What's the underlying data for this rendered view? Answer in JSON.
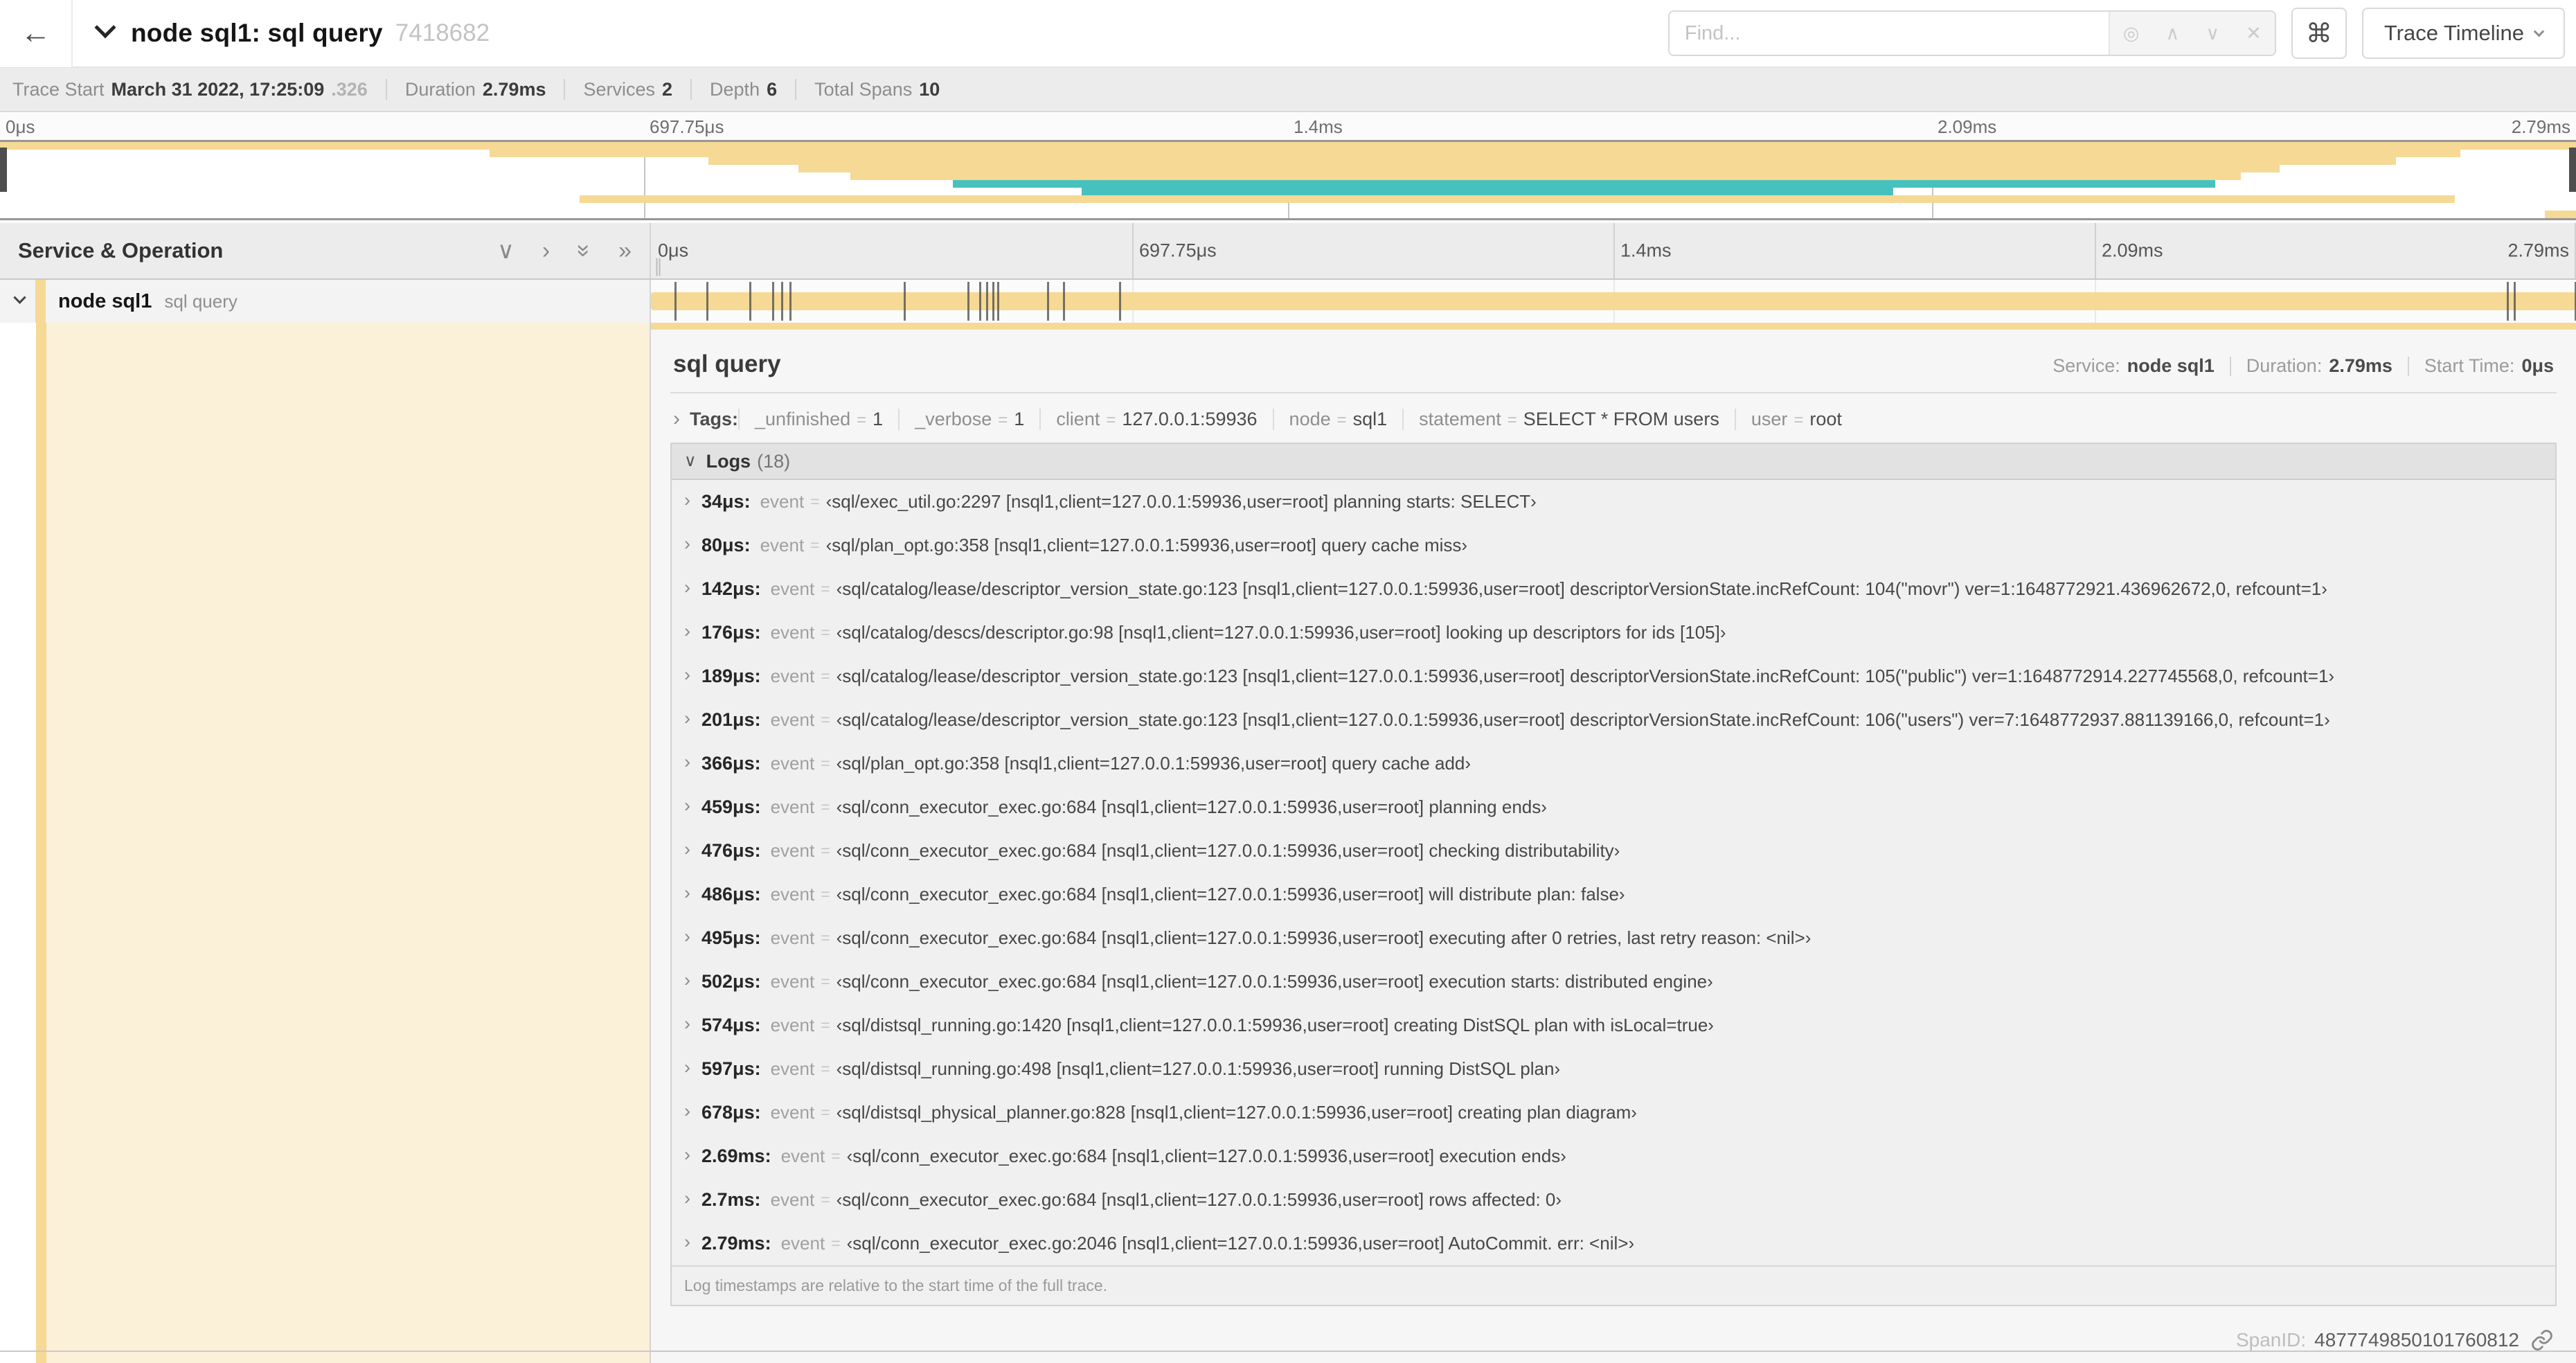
{
  "colors": {
    "tan": "#F5D995",
    "teal": "#47C1BE",
    "grid": "#d0d0d0"
  },
  "header": {
    "back_label": "←",
    "title": "node sql1: sql query",
    "trace_id": "7418682",
    "find_placeholder": "Find...",
    "focus_icon": "◎",
    "prev_icon": "∧",
    "next_icon": "∨",
    "clear_icon": "✕",
    "shortcut": "⌘",
    "view_button": "Trace Timeline"
  },
  "summary": {
    "items": [
      {
        "label": "Trace Start",
        "value": "March 31 2022, 17:25:09",
        "suffix": ".326"
      },
      {
        "label": "Duration",
        "value": "2.79ms",
        "suffix": ""
      },
      {
        "label": "Services",
        "value": "2",
        "suffix": ""
      },
      {
        "label": "Depth",
        "value": "6",
        "suffix": ""
      },
      {
        "label": "Total Spans",
        "value": "10",
        "suffix": ""
      }
    ]
  },
  "minimap": {
    "ticks": [
      {
        "label": "0μs",
        "pct": 0
      },
      {
        "label": "697.75μs",
        "pct": 25
      },
      {
        "label": "1.4ms",
        "pct": 50
      },
      {
        "label": "2.09ms",
        "pct": 75
      },
      {
        "label": "2.79ms",
        "pct": 100
      }
    ],
    "spans": [
      {
        "row": 0,
        "start": 0,
        "end": 100,
        "color": "tan"
      },
      {
        "row": 1,
        "start": 19,
        "end": 95.5,
        "color": "tan"
      },
      {
        "row": 2,
        "start": 27.5,
        "end": 93,
        "color": "tan"
      },
      {
        "row": 3,
        "start": 31,
        "end": 88.5,
        "color": "tan"
      },
      {
        "row": 4,
        "start": 33,
        "end": 87,
        "color": "tan"
      },
      {
        "row": 5,
        "start": 37,
        "end": 86,
        "color": "teal"
      },
      {
        "row": 6,
        "start": 42,
        "end": 73.5,
        "color": "teal"
      },
      {
        "row": 7,
        "start": 22.5,
        "end": 95.3,
        "color": "tan"
      },
      {
        "row": 9,
        "start": 98.8,
        "end": 100,
        "color": "tan"
      }
    ]
  },
  "timeline": {
    "left_header": "Service & Operation",
    "grip": "∥",
    "ticks": [
      {
        "label": "0μs",
        "pct": 0
      },
      {
        "label": "697.75μs",
        "pct": 25
      },
      {
        "label": "1.4ms",
        "pct": 50
      },
      {
        "label": "2.09ms",
        "pct": 75
      },
      {
        "label": "2.79ms",
        "pct": 100
      }
    ],
    "span": {
      "service": "node sql1",
      "operation": "sql query",
      "bar_start": 0,
      "bar_end": 100,
      "color": "tan"
    },
    "log_markers": [
      1.22,
      2.87,
      5.09,
      6.31,
      6.77,
      7.2,
      13.12,
      16.45,
      17.06,
      17.42,
      17.74,
      18.0,
      20.57,
      21.4,
      24.3,
      96.42,
      96.77,
      99.93
    ]
  },
  "detail": {
    "title": "sql query",
    "meta": [
      {
        "label": "Service:",
        "value": "node sql1"
      },
      {
        "label": "Duration:",
        "value": "2.79ms"
      },
      {
        "label": "Start Time:",
        "value": "0μs"
      }
    ],
    "tags_label": "Tags:",
    "tags": [
      {
        "key": "_unfinished",
        "value": "1"
      },
      {
        "key": "_verbose",
        "value": "1"
      },
      {
        "key": "client",
        "value": "127.0.0.1:59936"
      },
      {
        "key": "node",
        "value": "sql1"
      },
      {
        "key": "statement",
        "value": "SELECT * FROM users"
      },
      {
        "key": "user",
        "value": "root"
      }
    ],
    "logs_label": "Logs",
    "logs_count": "(18)",
    "logs": [
      {
        "time": "34μs:",
        "field": "event",
        "value": "‹sql/exec_util.go:2297 [nsql1,client=127.0.0.1:59936,user=root] planning starts: SELECT›"
      },
      {
        "time": "80μs:",
        "field": "event",
        "value": "‹sql/plan_opt.go:358 [nsql1,client=127.0.0.1:59936,user=root] query cache miss›"
      },
      {
        "time": "142μs:",
        "field": "event",
        "value": "‹sql/catalog/lease/descriptor_version_state.go:123 [nsql1,client=127.0.0.1:59936,user=root] descriptorVersionState.incRefCount: 104(\"movr\") ver=1:1648772921.436962672,0, refcount=1›"
      },
      {
        "time": "176μs:",
        "field": "event",
        "value": "‹sql/catalog/descs/descriptor.go:98 [nsql1,client=127.0.0.1:59936,user=root] looking up descriptors for ids [105]›"
      },
      {
        "time": "189μs:",
        "field": "event",
        "value": "‹sql/catalog/lease/descriptor_version_state.go:123 [nsql1,client=127.0.0.1:59936,user=root] descriptorVersionState.incRefCount: 105(\"public\") ver=1:1648772914.227745568,0, refcount=1›"
      },
      {
        "time": "201μs:",
        "field": "event",
        "value": "‹sql/catalog/lease/descriptor_version_state.go:123 [nsql1,client=127.0.0.1:59936,user=root] descriptorVersionState.incRefCount: 106(\"users\") ver=7:1648772937.881139166,0, refcount=1›"
      },
      {
        "time": "366μs:",
        "field": "event",
        "value": "‹sql/plan_opt.go:358 [nsql1,client=127.0.0.1:59936,user=root] query cache add›"
      },
      {
        "time": "459μs:",
        "field": "event",
        "value": "‹sql/conn_executor_exec.go:684 [nsql1,client=127.0.0.1:59936,user=root] planning ends›"
      },
      {
        "time": "476μs:",
        "field": "event",
        "value": "‹sql/conn_executor_exec.go:684 [nsql1,client=127.0.0.1:59936,user=root] checking distributability›"
      },
      {
        "time": "486μs:",
        "field": "event",
        "value": "‹sql/conn_executor_exec.go:684 [nsql1,client=127.0.0.1:59936,user=root] will distribute plan: false›"
      },
      {
        "time": "495μs:",
        "field": "event",
        "value": "‹sql/conn_executor_exec.go:684 [nsql1,client=127.0.0.1:59936,user=root] executing after 0 retries, last retry reason: <nil>›"
      },
      {
        "time": "502μs:",
        "field": "event",
        "value": "‹sql/conn_executor_exec.go:684 [nsql1,client=127.0.0.1:59936,user=root] execution starts: distributed engine›"
      },
      {
        "time": "574μs:",
        "field": "event",
        "value": "‹sql/distsql_running.go:1420 [nsql1,client=127.0.0.1:59936,user=root] creating DistSQL plan with isLocal=true›"
      },
      {
        "time": "597μs:",
        "field": "event",
        "value": "‹sql/distsql_running.go:498 [nsql1,client=127.0.0.1:59936,user=root] running DistSQL plan›"
      },
      {
        "time": "678μs:",
        "field": "event",
        "value": "‹sql/distsql_physical_planner.go:828 [nsql1,client=127.0.0.1:59936,user=root] creating plan diagram›"
      },
      {
        "time": "2.69ms:",
        "field": "event",
        "value": "‹sql/conn_executor_exec.go:684 [nsql1,client=127.0.0.1:59936,user=root] execution ends›"
      },
      {
        "time": "2.7ms:",
        "field": "event",
        "value": "‹sql/conn_executor_exec.go:684 [nsql1,client=127.0.0.1:59936,user=root] rows affected: 0›"
      },
      {
        "time": "2.79ms:",
        "field": "event",
        "value": "‹sql/conn_executor_exec.go:2046 [nsql1,client=127.0.0.1:59936,user=root] AutoCommit. err: <nil>›"
      }
    ],
    "logs_footer": "Log timestamps are relative to the start time of the full trace.",
    "span_id_label": "SpanID:",
    "span_id": "4877749850101760812"
  }
}
